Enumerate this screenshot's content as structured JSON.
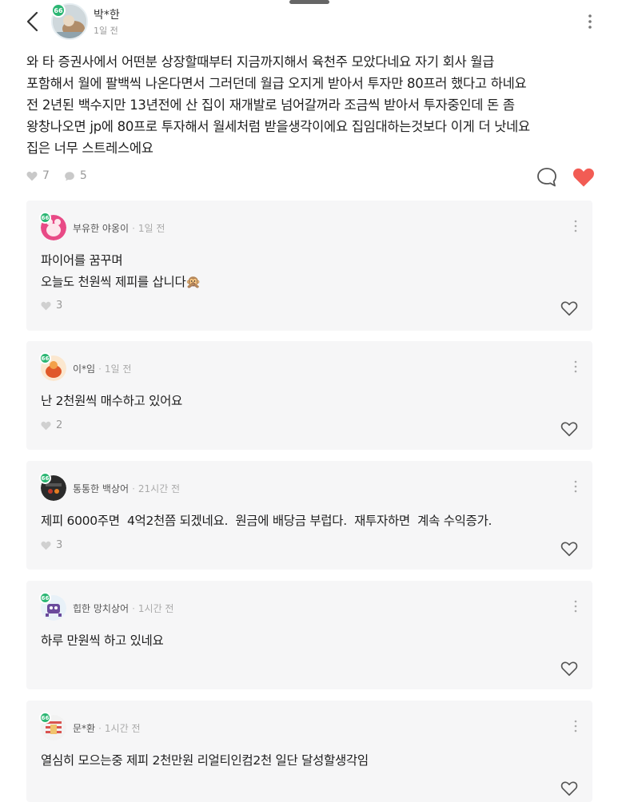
{
  "post": {
    "author": "박*한",
    "time": "1일 전",
    "badge": "66",
    "body_lines": [
      "와 타 증권사에서 어떤분 상장할때부터 지금까지해서 육천주 모았다네요 자기 회사 월급",
      "포함해서 월에 팔백씩 나온다면서 그러던데 월급 오지게 받아서 투자만 80프러 했다고 하네요",
      "전 2년된 백수지만 13년전에 산 집이 재개발로 넘어갈꺼라 조금씩 받아서 투자중인데 돈 좀",
      "왕창나오면 jp에 80프로 투자해서 월세처럼 받을생각이에요 집임대하는것보다 이게 더 낫네요",
      "집은 너무 스트레스에요"
    ],
    "likes": "7",
    "comments": "5"
  },
  "comments": [
    {
      "author": "부유한 야옹이",
      "time": "1일 전",
      "lines": [
        "파이어를 꿈꾸며",
        "오늘도 천원씩 제피를 삽니다🙊"
      ],
      "likes": "3",
      "badge": "66"
    },
    {
      "author": "이*임",
      "time": "1일 전",
      "lines": [
        "난 2천원씩 매수하고 있어요"
      ],
      "likes": "2",
      "badge": "66"
    },
    {
      "author": "통통한 백상어",
      "time": "21시간 전",
      "lines": [
        "제피 6000주면  4억2천쯤 되겠네요.  원금에 배당금 부럽다.  재투자하면  계속 수익증가."
      ],
      "likes": "3",
      "badge": "66"
    },
    {
      "author": "힙한 망치상어",
      "time": "1시간 전",
      "lines": [
        "하루 만원씩 하고 있네요"
      ],
      "likes": "",
      "badge": "66"
    },
    {
      "author": "문*환",
      "time": "1시간 전",
      "lines": [
        "열심히 모으는중 제피 2천만원 리얼티인컴2천 일단 달성할생각임"
      ],
      "likes": "",
      "badge": "66"
    }
  ],
  "colors": {
    "accent_heart": "#f25c54",
    "badge": "#2bb673",
    "card_bg": "#f6f6f7"
  }
}
